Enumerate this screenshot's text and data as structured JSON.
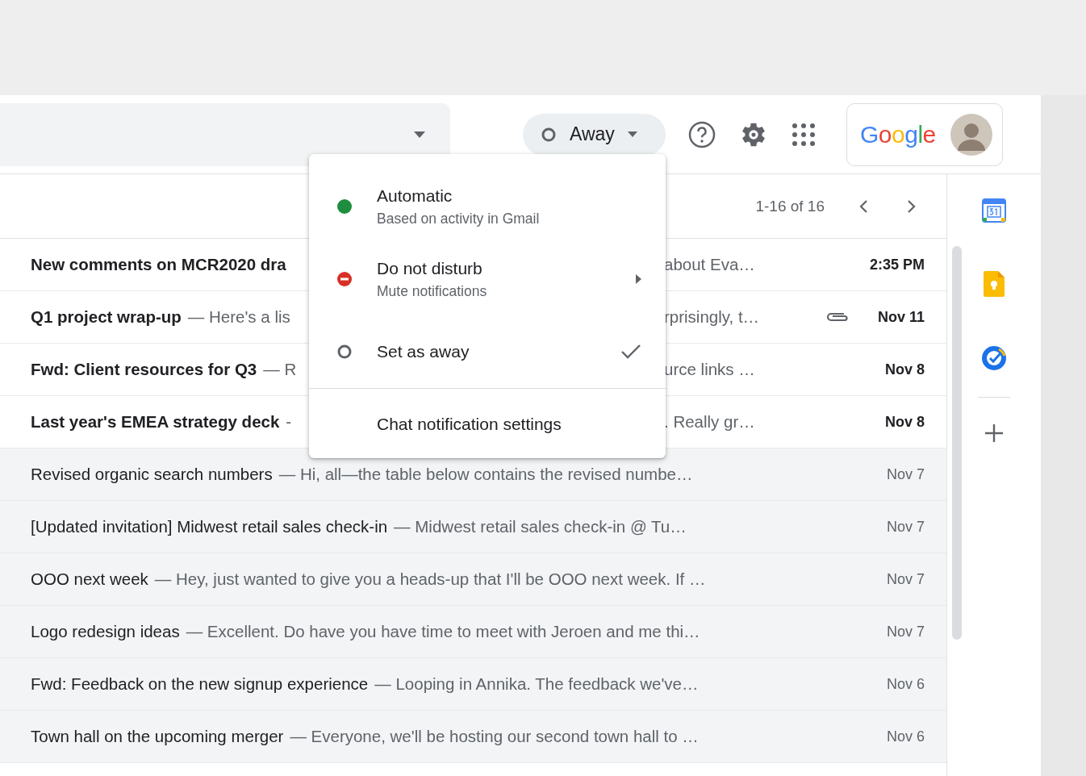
{
  "status_chip": {
    "label": "Away"
  },
  "account": {
    "logo": "Google"
  },
  "pagination": {
    "range": "1-16 of 16"
  },
  "status_menu": {
    "items": [
      {
        "kind": "dot",
        "color": "#1e8e3e",
        "label": "Automatic",
        "sub": "Based on activity in Gmail",
        "selected": false,
        "submenu": false
      },
      {
        "kind": "dnd",
        "color": "#d93025",
        "label": "Do not disturb",
        "sub": "Mute notifications",
        "selected": false,
        "submenu": true
      },
      {
        "kind": "ring",
        "color": "#5f6368",
        "label": "Set as away",
        "selected": true,
        "submenu": false
      }
    ],
    "footer": "Chat notification settings"
  },
  "messages": [
    {
      "subject": "New comments on MCR2020 dra",
      "snippet_end": "about Eva…",
      "date": "2:35 PM",
      "unread": true,
      "attachment": false
    },
    {
      "subject": "Q1 project wrap-up",
      "snippet": "— Here's a lis",
      "snippet_end": "rprisingly, t…",
      "date": "Nov 11",
      "unread": true,
      "attachment": true
    },
    {
      "subject": "Fwd: Client resources for Q3",
      "snippet": "— R",
      "snippet_end": "urce links …",
      "date": "Nov 8",
      "unread": true,
      "attachment": false
    },
    {
      "subject": "Last year's EMEA strategy deck",
      "snippet": "-",
      "snippet_end": ". Really gr…",
      "date": "Nov 8",
      "unread": true,
      "attachment": false
    },
    {
      "subject": "Revised organic search numbers",
      "snippet": "— Hi, all—the table below contains the revised numbe…",
      "date": "Nov 7",
      "unread": false,
      "attachment": false
    },
    {
      "subject": "[Updated invitation] Midwest retail sales check-in",
      "snippet": "— Midwest retail sales check-in @ Tu…",
      "date": "Nov 7",
      "unread": false,
      "attachment": false
    },
    {
      "subject": "OOO next week",
      "snippet": "— Hey, just wanted to give you a heads-up that I'll be OOO next week. If …",
      "date": "Nov 7",
      "unread": false,
      "attachment": false
    },
    {
      "subject": "Logo redesign ideas",
      "snippet": "— Excellent. Do have you have time to meet with Jeroen and me thi…",
      "date": "Nov 7",
      "unread": false,
      "attachment": false
    },
    {
      "subject": "Fwd: Feedback on the new signup experience",
      "snippet": "— Looping in Annika. The feedback we've…",
      "date": "Nov 6",
      "unread": false,
      "attachment": false
    },
    {
      "subject": "Town hall on the upcoming merger",
      "snippet": "— Everyone, we'll be hosting our second town hall to …",
      "date": "Nov 6",
      "unread": false,
      "attachment": false
    }
  ]
}
